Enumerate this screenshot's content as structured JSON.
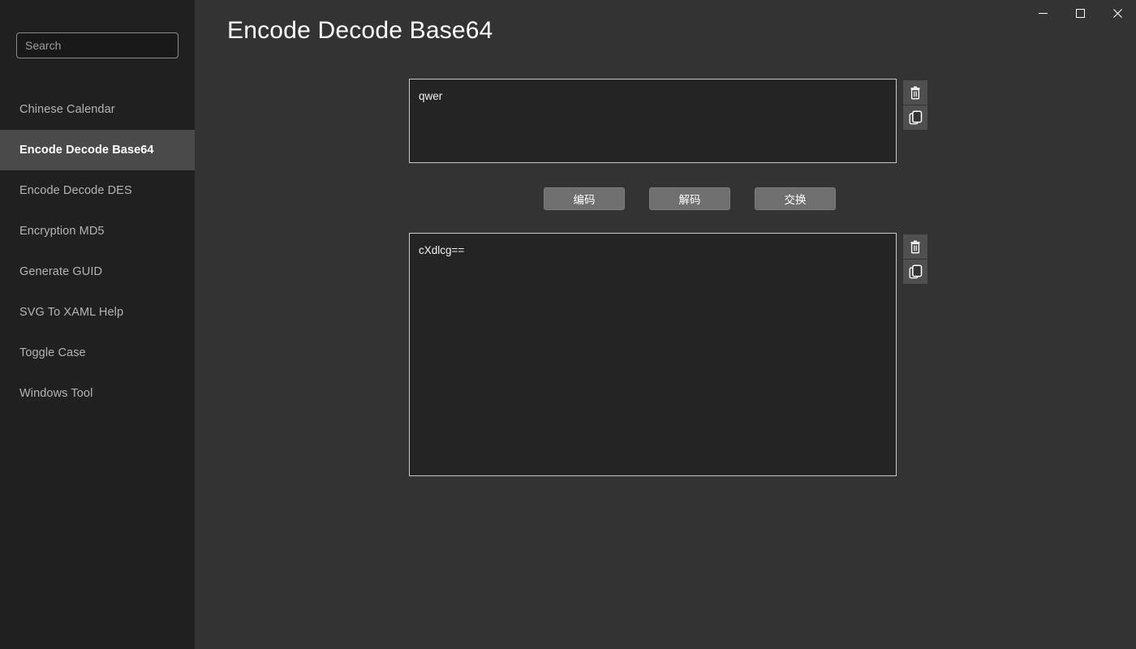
{
  "window": {
    "controls": [
      {
        "name": "minimize",
        "glyph": "minimize-icon"
      },
      {
        "name": "maximize",
        "glyph": "maximize-icon"
      },
      {
        "name": "close",
        "glyph": "close-icon"
      }
    ]
  },
  "sidebar": {
    "search": {
      "placeholder": "Search",
      "value": ""
    },
    "items": [
      {
        "label": "Chinese Calendar",
        "selected": false
      },
      {
        "label": "Encode Decode Base64",
        "selected": true
      },
      {
        "label": "Encode Decode DES",
        "selected": false
      },
      {
        "label": "Encryption MD5",
        "selected": false
      },
      {
        "label": "Generate GUID",
        "selected": false
      },
      {
        "label": "SVG To XAML Help",
        "selected": false
      },
      {
        "label": "Toggle Case",
        "selected": false
      },
      {
        "label": "Windows Tool",
        "selected": false
      }
    ]
  },
  "main": {
    "title": "Encode Decode Base64",
    "input": {
      "value": "qwer",
      "placeholder": "",
      "clear_icon": "trash-icon",
      "copy_icon": "copy-icon"
    },
    "output": {
      "value": "cXdlcg==",
      "placeholder": "",
      "clear_icon": "trash-icon",
      "copy_icon": "copy-icon"
    },
    "actions": [
      {
        "label": "编码",
        "name": "encode"
      },
      {
        "label": "解码",
        "name": "decode"
      },
      {
        "label": "交换",
        "name": "swap"
      }
    ]
  },
  "colors": {
    "sidebar_bg": "#202020",
    "content_bg": "#333333",
    "selected_item_bg": "#4a4a4a",
    "textarea_bg": "#242424",
    "textarea_border": "#c8c8c8",
    "button_bg": "#6f6f6f",
    "icon_button_bg": "#4f4f4f",
    "text_primary": "#ffffff",
    "text_secondary": "#b4b4b4"
  }
}
